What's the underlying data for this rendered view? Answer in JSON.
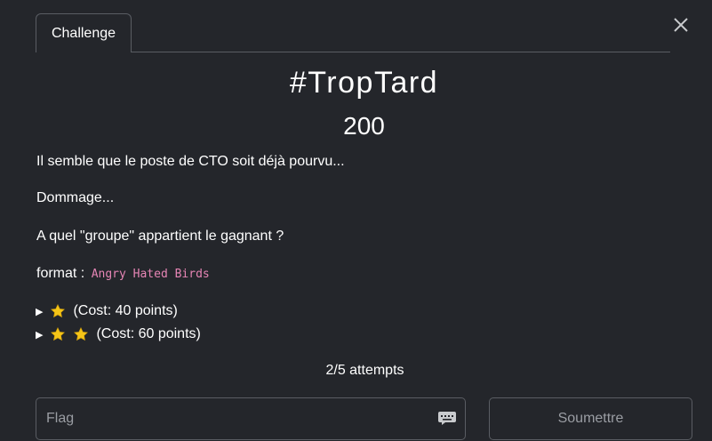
{
  "modal": {
    "close_label": "×",
    "tab_label": "Challenge"
  },
  "challenge": {
    "name": "#TropTard",
    "value": "200",
    "description": {
      "line1": "Il semble que le poste de CTO soit déjà pourvu...",
      "line2": "Dommage...",
      "line3": "A quel \"groupe\" appartient le gagnant ?",
      "format_label": "format :",
      "format_example": "Angry Hated Birds"
    }
  },
  "hints": [
    {
      "stars": 1,
      "label": "(Cost: 40 points)"
    },
    {
      "stars": 2,
      "label": "(Cost: 60 points)"
    }
  ],
  "attempts": "2/5 attempts",
  "submission": {
    "flag_placeholder": "Flag",
    "flag_value": "",
    "submit_label": "Soumettre"
  },
  "icons": {
    "close": "close-icon",
    "hint_caret": "caret-right-icon",
    "star": "star-icon",
    "keyboard": "keyboard-icon"
  },
  "colors": {
    "background": "#24262b",
    "border": "#5a5d63",
    "code": "#e685b5",
    "star": "#f5c518",
    "muted_text": "#9a9da3"
  }
}
